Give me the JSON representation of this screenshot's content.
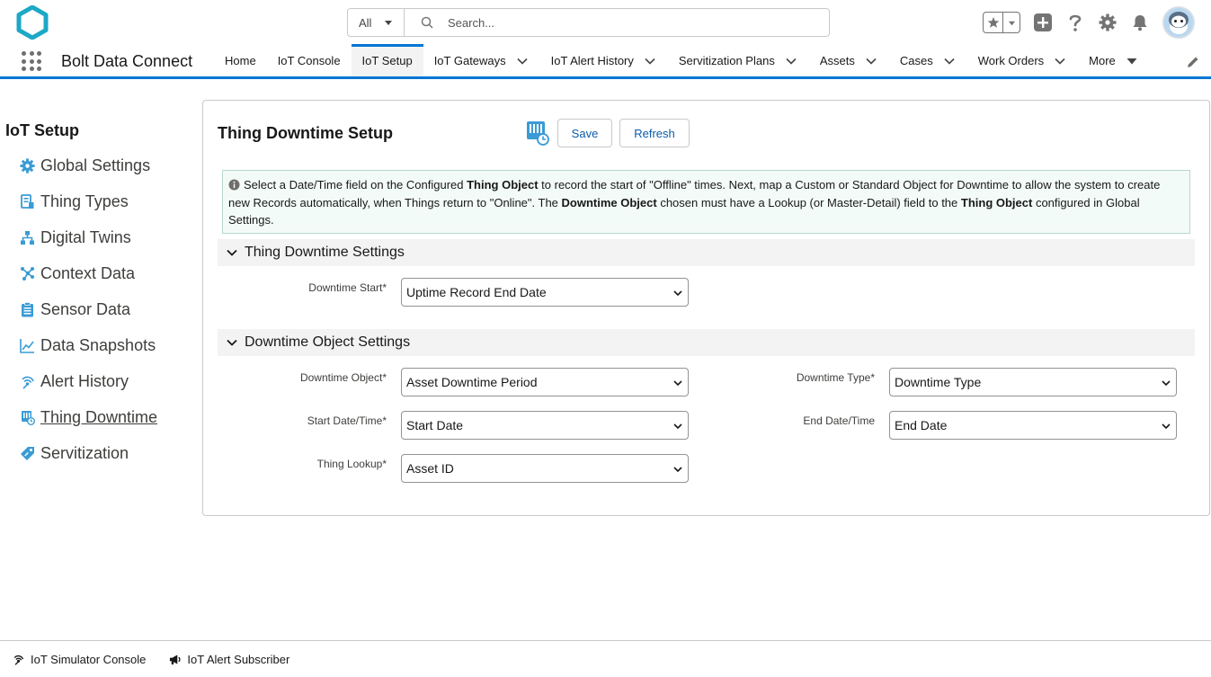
{
  "colors": {
    "brand": "#0176d3",
    "logo": "#1ca8c6",
    "icon_blue": "#3a9bd5",
    "info_bg": "#f3fbf8"
  },
  "search": {
    "scope": "All",
    "placeholder": "Search..."
  },
  "nav": {
    "app_name": "Bolt Data Connect",
    "items": [
      {
        "label": "Home"
      },
      {
        "label": "IoT Console"
      },
      {
        "label": "IoT Setup"
      },
      {
        "label": "IoT Gateways"
      },
      {
        "label": "IoT Alert History"
      },
      {
        "label": "Servitization Plans"
      },
      {
        "label": "Assets"
      },
      {
        "label": "Cases"
      },
      {
        "label": "Work Orders"
      },
      {
        "label": "More"
      }
    ]
  },
  "sidebar": {
    "title": "IoT Setup",
    "items": [
      {
        "label": "Global Settings",
        "icon": "gear-icon"
      },
      {
        "label": "Thing Types",
        "icon": "thing-types-icon"
      },
      {
        "label": "Digital Twins",
        "icon": "hierarchy-icon"
      },
      {
        "label": "Context Data",
        "icon": "network-icon"
      },
      {
        "label": "Sensor Data",
        "icon": "clipboard-icon"
      },
      {
        "label": "Data Snapshots",
        "icon": "line-chart-icon"
      },
      {
        "label": "Alert History",
        "icon": "signal-icon"
      },
      {
        "label": "Thing Downtime",
        "icon": "downtime-icon"
      },
      {
        "label": "Servitization",
        "icon": "tag-icon"
      }
    ]
  },
  "main": {
    "title": "Thing Downtime Setup",
    "save_label": "Save",
    "refresh_label": "Refresh",
    "info": {
      "p1": "Select a Date/Time field on the Configured ",
      "b1": "Thing Object",
      "p2": " to record the start of \"Offline\" times. Next, map a Custom or Standard Object for Downtime to allow the system to create new Records automatically, when Things return to \"Online\". The ",
      "b2": "Downtime Object",
      "p3": " chosen must have a Lookup (or Master-Detail) field to the ",
      "b3": "Thing Object",
      "p4": " configured in Global Settings."
    },
    "section1": {
      "title": "Thing Downtime Settings",
      "downtime_start_label": "Downtime Start*",
      "downtime_start_value": "Uptime Record End Date"
    },
    "section2": {
      "title": "Downtime Object Settings",
      "downtime_object_label": "Downtime Object*",
      "downtime_object_value": "Asset Downtime Period",
      "start_label": "Start Date/Time*",
      "start_value": "Start Date",
      "lookup_label": "Thing Lookup*",
      "lookup_value": "Asset ID",
      "type_label": "Downtime Type*",
      "type_value": "Downtime Type",
      "end_label": "End Date/Time",
      "end_value": "End Date"
    }
  },
  "footer": {
    "items": [
      {
        "label": "IoT Simulator Console"
      },
      {
        "label": "IoT Alert Subscriber"
      }
    ]
  }
}
